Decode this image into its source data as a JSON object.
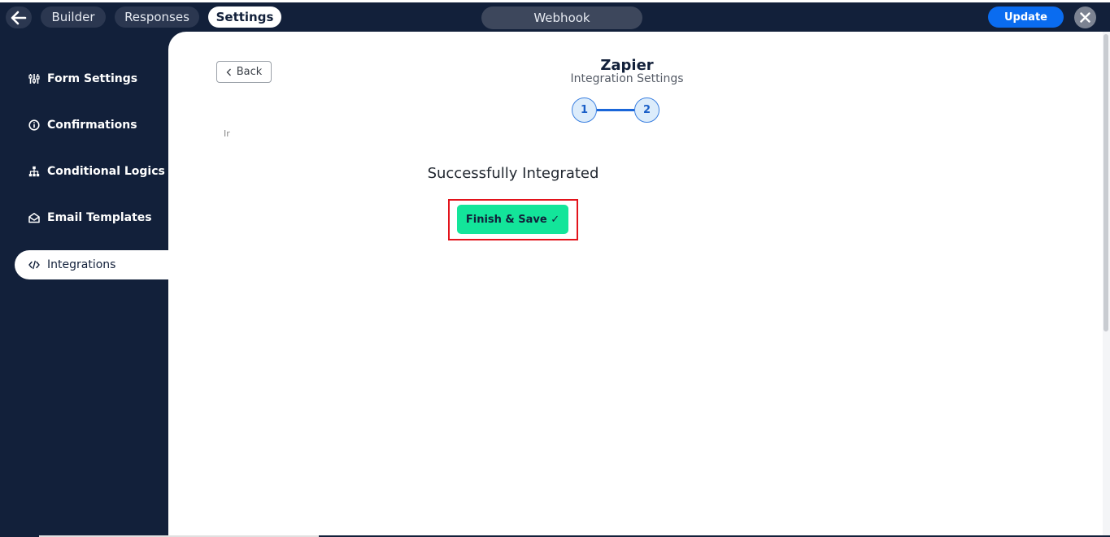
{
  "topbar": {
    "tabs": [
      {
        "label": "Builder",
        "active": false
      },
      {
        "label": "Responses",
        "active": false
      },
      {
        "label": "Settings",
        "active": true
      }
    ],
    "center_label": "Webhook",
    "update_label": "Update"
  },
  "sidebar": {
    "items": [
      {
        "label": "Form Settings",
        "icon": "sliders-icon"
      },
      {
        "label": "Confirmations",
        "icon": "info-icon"
      },
      {
        "label": "Conditional Logics",
        "icon": "hierarchy-icon"
      },
      {
        "label": "Email Templates",
        "icon": "envelope-open-icon"
      },
      {
        "label": "Integrations",
        "icon": "code-icon",
        "active": true
      }
    ]
  },
  "main": {
    "back_label": "Back",
    "title": "Zapier",
    "subtitle": "Integration Settings",
    "steps": [
      "1",
      "2"
    ],
    "truncated_text": "Ir",
    "success_message": "Successfully Integrated",
    "finish_label": "Finish & Save ✓"
  },
  "colors": {
    "navy": "#12203a",
    "update_blue": "#0a6cf0",
    "finish_green": "#13e59a",
    "highlight_red": "#e3131b"
  }
}
